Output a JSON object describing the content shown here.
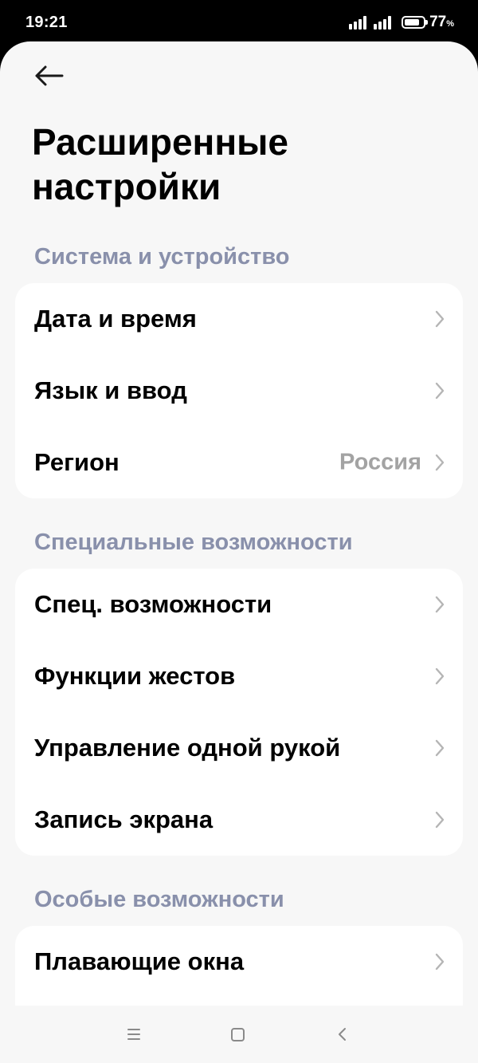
{
  "status_bar": {
    "time": "19:21",
    "battery_percent": "77",
    "battery_unit": "%",
    "battery_level": 0.77,
    "icons": [
      "signal-icon",
      "signal-icon",
      "battery-icon"
    ]
  },
  "header": {
    "back_icon": "arrow-left-icon",
    "title": "Расширенные настройки"
  },
  "sections": [
    {
      "title": "Система и устройство",
      "items": [
        {
          "label": "Дата и время"
        },
        {
          "label": "Язык и ввод"
        },
        {
          "label": "Регион",
          "value": "Россия"
        }
      ]
    },
    {
      "title": "Специальные возможности",
      "items": [
        {
          "label": "Спец. возможности"
        },
        {
          "label": "Функции жестов"
        },
        {
          "label": "Управление одной рукой"
        },
        {
          "label": "Запись экрана"
        }
      ]
    },
    {
      "title": "Особые возможности",
      "items": [
        {
          "label": "Плавающие окна"
        }
      ]
    }
  ],
  "nav_bar": {
    "icons": [
      "menu-icon",
      "home-icon",
      "back-icon"
    ]
  },
  "colors": {
    "background": "#f7f7f7",
    "card": "#ffffff",
    "section_header": "#8990ab",
    "secondary_value": "#a3a3a3",
    "chevron": "#b5b5b5"
  }
}
